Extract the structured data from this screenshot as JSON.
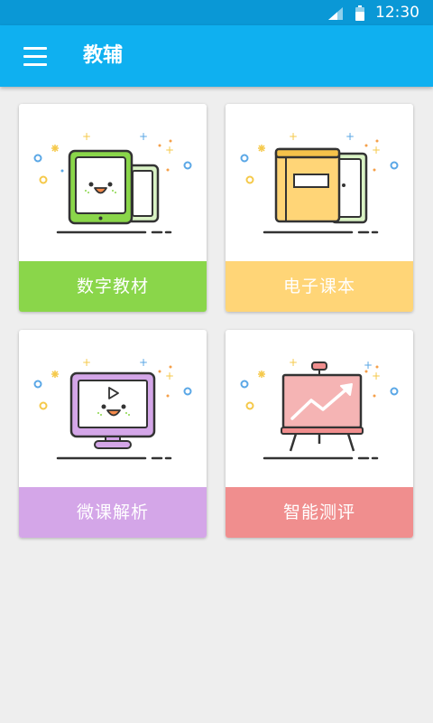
{
  "status_bar": {
    "time": "12:30",
    "icons": [
      "signal-icon",
      "battery-icon"
    ]
  },
  "app_bar": {
    "title": "教辅",
    "menu_icon": "hamburger-menu-icon"
  },
  "colors": {
    "status_bar": "#0a98d6",
    "app_bar": "#0fb0f0",
    "background": "#eeeeee"
  },
  "cards": [
    {
      "label": "数字教材",
      "color": "#8ad64a",
      "icon": "tablet-icon"
    },
    {
      "label": "电子课本",
      "color": "#ffd577",
      "icon": "book-icon"
    },
    {
      "label": "微课解析",
      "color": "#d4a6e8",
      "icon": "monitor-play-icon"
    },
    {
      "label": "智能测评",
      "color": "#f08e8e",
      "icon": "growth-chart-board-icon"
    }
  ]
}
